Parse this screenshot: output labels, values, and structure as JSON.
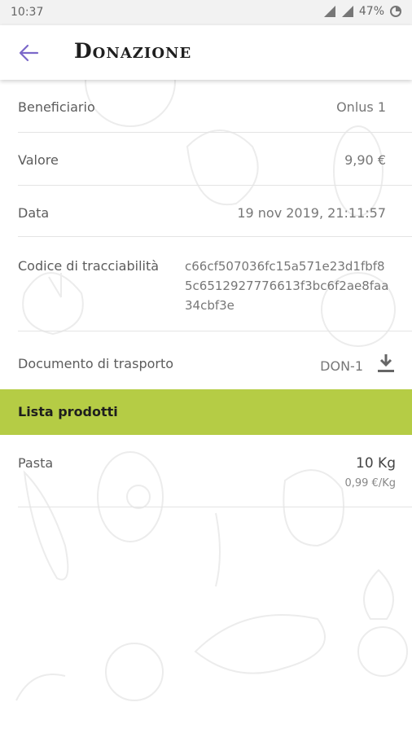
{
  "status_bar": {
    "time": "10:37",
    "battery": "47%",
    "network": "4G",
    "icons": [
      "signal-icon",
      "signal-icon",
      "battery-icon"
    ]
  },
  "app_bar": {
    "title": "Donazione",
    "back_icon": "arrow-left-icon",
    "accent_color": "#7b68c9"
  },
  "details": {
    "beneficiario_label": "Beneficiario",
    "beneficiario_value": "Onlus 1",
    "valore_label": "Valore",
    "valore_value": "9,90 €",
    "data_label": "Data",
    "data_value": "19 nov 2019, 21:11:57",
    "codice_label": "Codice di tracciabilità",
    "codice_value": "c66cf507036fc15a571e23d1fbf85c6512927776613f3bc6f2ae8faa34cbf3e",
    "documento_label": "Documento di trasporto",
    "documento_value": "DON-1",
    "download_icon": "download-icon"
  },
  "products_section": {
    "title": "Lista prodotti",
    "color": "#b5cc45",
    "items": [
      {
        "name": "Pasta",
        "quantity": "10 Kg",
        "unit_price": "0,99 €/Kg"
      }
    ]
  }
}
